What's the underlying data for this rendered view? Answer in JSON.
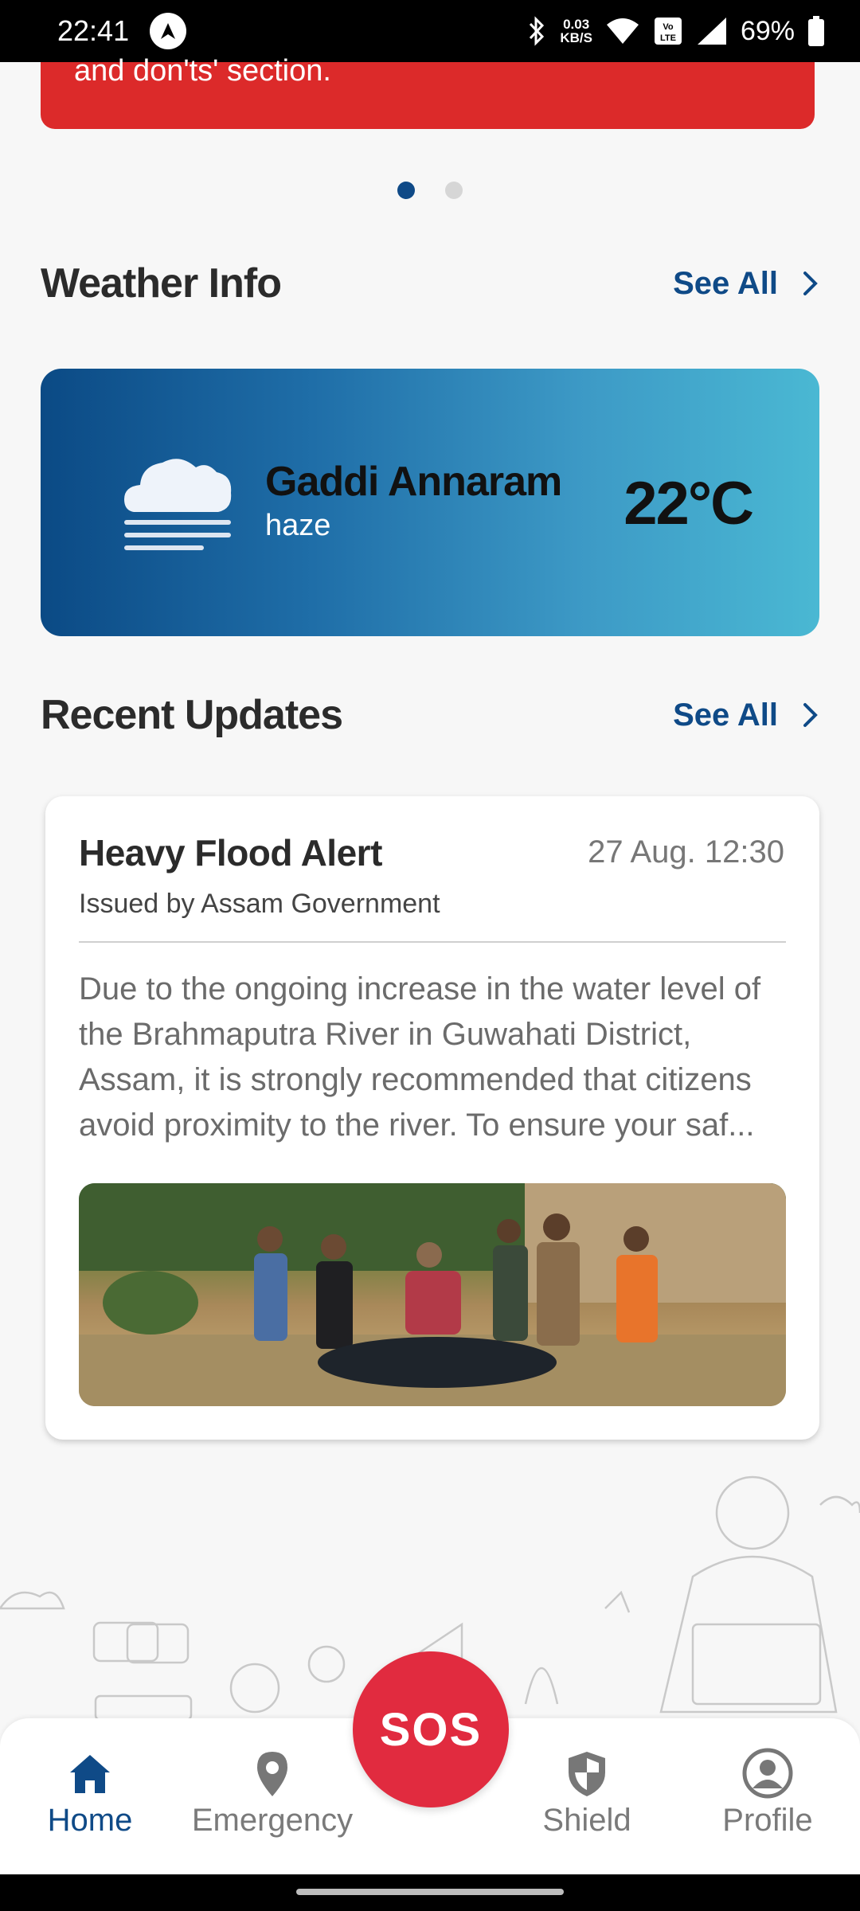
{
  "status_bar": {
    "time": "22:41",
    "speed_value": "0.03",
    "speed_unit": "KB/S",
    "battery": "69%",
    "icons": [
      "navigation-arrow-icon",
      "bluetooth-icon",
      "wifi-icon",
      "volte-icon",
      "signal-icon",
      "battery-icon"
    ]
  },
  "banner": {
    "text": "and don'ts' section.",
    "color": "#dc2a2a"
  },
  "carousel": {
    "pages": 2,
    "active_index": 0
  },
  "weather": {
    "section_title": "Weather Info",
    "see_all": "See All",
    "location": "Gaddi Annaram",
    "condition": "haze",
    "temperature": "22°C",
    "icon": "haze-cloud-icon"
  },
  "updates": {
    "section_title": "Recent Updates",
    "see_all": "See All",
    "items": [
      {
        "title": "Heavy Flood Alert",
        "time": "27 Aug. 12:30",
        "issuer": "Issued by Assam Government",
        "body": "Due to the ongoing increase in the water level of the Brahmaputra River in Guwahati District, Assam, it is strongly recommended that citizens avoid proximity to the river. To ensure your saf...",
        "image": "flood-rescue-photo"
      }
    ]
  },
  "bottom_nav": {
    "items": [
      {
        "label": "Home",
        "icon": "home-icon",
        "active": true
      },
      {
        "label": "Emergency",
        "icon": "location-pin-icon",
        "active": false
      },
      {
        "label": "Shield",
        "icon": "shield-icon",
        "active": false
      },
      {
        "label": "Profile",
        "icon": "profile-icon",
        "active": false
      }
    ],
    "sos_label": "SOS"
  },
  "colors": {
    "accent": "#0f4a87",
    "sos": "#e12b3f"
  }
}
